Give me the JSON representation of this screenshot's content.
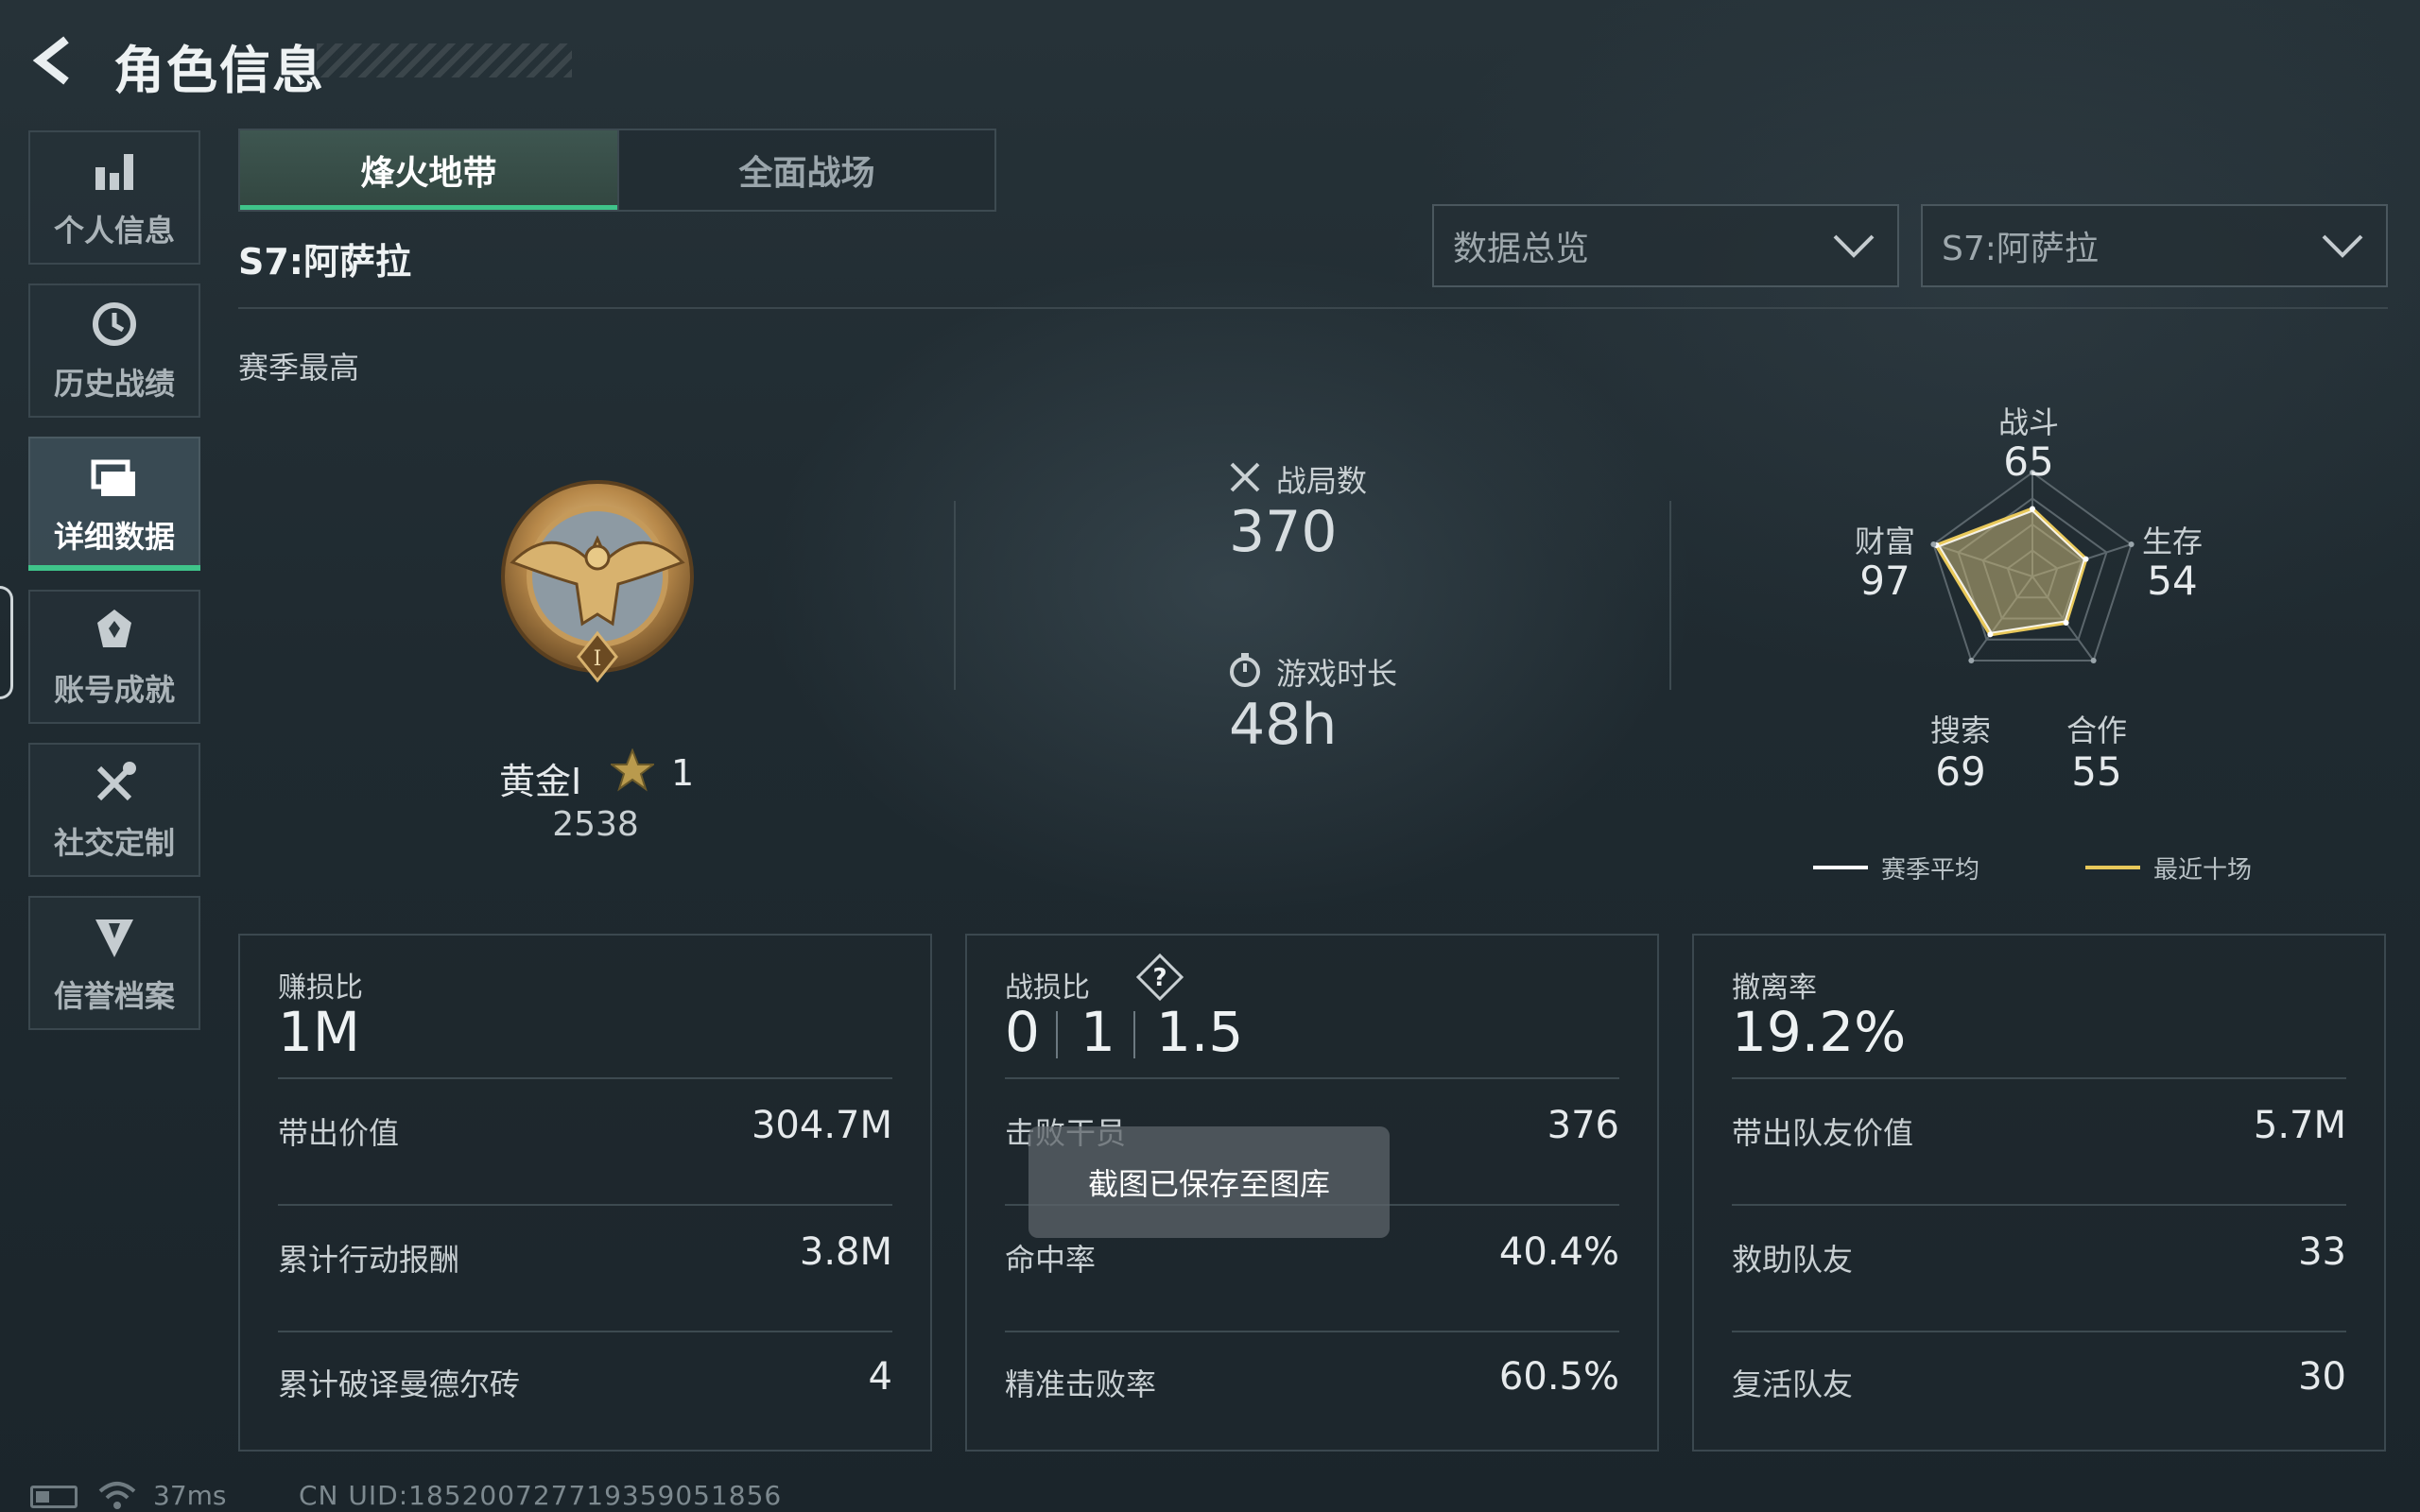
{
  "header": {
    "title": "角色信息"
  },
  "sidebar": {
    "items": [
      {
        "label": "个人信息",
        "icon": "bar-chart-icon",
        "active": false
      },
      {
        "label": "历史战绩",
        "icon": "history-icon",
        "active": false
      },
      {
        "label": "详细数据",
        "icon": "folder-icon",
        "active": true
      },
      {
        "label": "账号成就",
        "icon": "achievement-icon",
        "active": false
      },
      {
        "label": "社交定制",
        "icon": "tools-icon",
        "active": false
      },
      {
        "label": "信誉档案",
        "icon": "shield-icon",
        "active": false
      }
    ]
  },
  "tabs": [
    {
      "label": "烽火地带",
      "active": true
    },
    {
      "label": "全面战场",
      "active": false
    }
  ],
  "season_title": "S7:阿萨拉",
  "filters": {
    "category": "数据总览",
    "season": "S7:阿萨拉"
  },
  "section_label": "赛季最高",
  "rank": {
    "name": "黄金Ⅰ",
    "stars": "1",
    "score": "2538"
  },
  "stats": {
    "matches": {
      "label": "战局数",
      "value": "370"
    },
    "playtime": {
      "label": "游戏时长",
      "value": "48h"
    }
  },
  "radar": {
    "axes": [
      {
        "label": "战斗",
        "value": "65"
      },
      {
        "label": "生存",
        "value": "54"
      },
      {
        "label": "合作",
        "value": "55"
      },
      {
        "label": "搜索",
        "value": "69"
      },
      {
        "label": "财富",
        "value": "97"
      }
    ],
    "legend": {
      "season_avg": "赛季平均",
      "recent_ten": "最近十场"
    },
    "colors": {
      "season_avg": "#ffffff",
      "recent_ten": "#e8c85a"
    }
  },
  "cards": {
    "profit": {
      "label": "赚损比",
      "value": "1M",
      "rows": [
        {
          "label": "带出价值",
          "value": "304.7M"
        },
        {
          "label": "累计行动报酬",
          "value": "3.8M"
        },
        {
          "label": "累计破译曼德尔砖",
          "value": "4"
        }
      ]
    },
    "kdr": {
      "label": "战损比",
      "values": [
        "0",
        "1",
        "1.5"
      ],
      "rows": [
        {
          "label": "击败干员",
          "value": "376"
        },
        {
          "label": "命中率",
          "value": "40.4%"
        },
        {
          "label": "精准击败率",
          "value": "60.5%"
        }
      ]
    },
    "extract": {
      "label": "撤离率",
      "value": "19.2%",
      "rows": [
        {
          "label": "带出队友价值",
          "value": "5.7M"
        },
        {
          "label": "救助队友",
          "value": "33"
        },
        {
          "label": "复活队友",
          "value": "30"
        }
      ]
    }
  },
  "toast": "截图已保存至图库",
  "footer": {
    "ping": "37ms",
    "uid": "CN UID:18520072771935905185​6"
  }
}
